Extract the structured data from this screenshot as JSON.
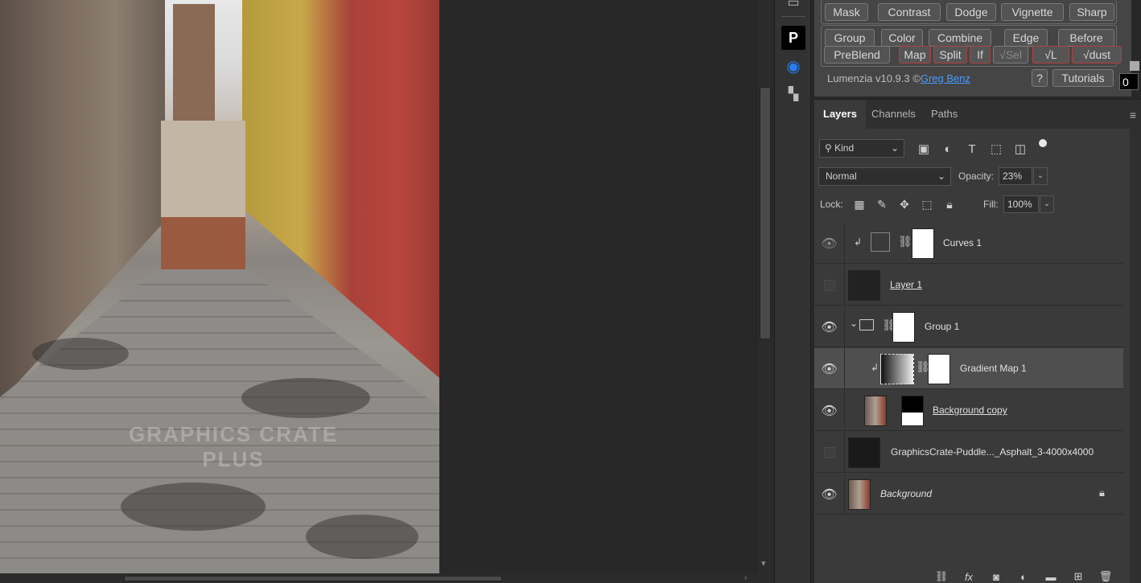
{
  "lumenzia": {
    "row1": [
      "Mask",
      "Contrast",
      "Dodge",
      "Vignette",
      "Sharp"
    ],
    "row2": [
      "Group",
      "Color",
      "Combine",
      "Edge",
      "Before"
    ],
    "row3": [
      "PreBlend",
      "Map",
      "Split",
      "If",
      "√Sel",
      "√L",
      "√dust"
    ],
    "version": "Lumenzia v10.9.3 ©",
    "author": "Greg Benz",
    "help": "?",
    "tutorials": "Tutorials",
    "value_box": "0"
  },
  "layers_panel": {
    "tabs": [
      "Layers",
      "Channels",
      "Paths"
    ],
    "filter_kind": "Kind",
    "blend_mode": "Normal",
    "opacity_label": "Opacity:",
    "opacity_value": "23%",
    "lock_label": "Lock:",
    "fill_label": "Fill:",
    "fill_value": "100%",
    "layers": [
      {
        "name": "Curves 1",
        "visible": true
      },
      {
        "name": "Layer 1",
        "visible": false
      },
      {
        "name": "Group 1",
        "visible": true
      },
      {
        "name": "Gradient Map 1",
        "visible": true,
        "selected": true
      },
      {
        "name": "Background copy",
        "visible": true
      },
      {
        "name": "GraphicsCrate-Puddle..._Asphalt_3-4000x4000",
        "visible": false
      },
      {
        "name": "Background",
        "visible": true,
        "locked": true
      }
    ]
  },
  "canvas": {
    "watermark": "GRAPHICS CRATE PLUS"
  }
}
